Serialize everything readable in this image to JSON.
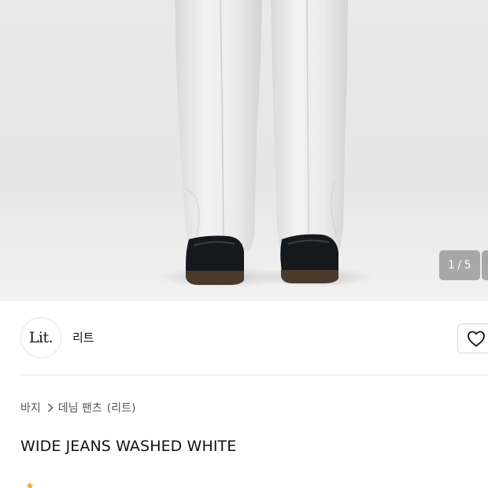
{
  "product_image": {
    "counter_current": "1",
    "counter_separator": "/",
    "counter_total": "5"
  },
  "brand": {
    "logo_text": "Lit.",
    "name": "리트"
  },
  "breadcrumb": {
    "category": "바지",
    "subcategory": "데님 팬츠",
    "brand_tag": "(리트)"
  },
  "product": {
    "title": "WIDE JEANS WASHED WHITE"
  },
  "icons": {
    "like": "heart-icon",
    "breadcrumb_separator": "chevron-right-icon",
    "rating": "star-icon"
  },
  "colors": {
    "counter_bg": "#8c8c8c",
    "star": "#f5a623"
  }
}
